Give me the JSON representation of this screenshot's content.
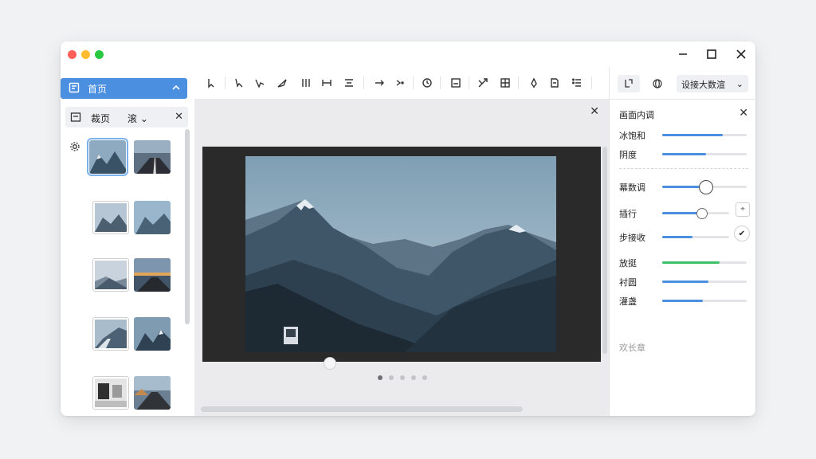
{
  "window": {
    "controls": {
      "minimize": "–",
      "maximize": "☐",
      "close": "✕"
    }
  },
  "sidebar": {
    "home_label": "首页",
    "panel": {
      "label": "裁页",
      "dropdown": "滚",
      "close": "✕"
    },
    "thumbnails": [
      {
        "icon": "mountain-thumbnail"
      },
      {
        "icon": "road-thumbnail"
      },
      {
        "icon": "mountain-thumbnail"
      },
      {
        "icon": "mountain-thumbnail"
      },
      {
        "icon": "mountain-thumbnail"
      },
      {
        "icon": "road-thumbnail"
      },
      {
        "icon": "road-thumbnail"
      },
      {
        "icon": "mountain-thumbnail"
      },
      {
        "icon": "room-thumbnail"
      },
      {
        "icon": "road-thumbnail"
      }
    ]
  },
  "toolbar": {
    "tools": [
      "select",
      "pointer",
      "lasso",
      "brush",
      "flip",
      "align",
      "separator",
      "spacing",
      "dots",
      "timer",
      "export",
      "transform",
      "grid",
      "pen",
      "document",
      "list"
    ]
  },
  "canvas": {
    "close": "✕",
    "pages": 5,
    "active_page": 1
  },
  "right_panel": {
    "dropdown_label": "设接大数渲",
    "dropdown_chevron": "⌄",
    "title": "画面内调",
    "close": "✕",
    "adjustments": [
      {
        "label": "冰饱和",
        "value": 0.72,
        "color": "#4a8fe0"
      },
      {
        "label": "阴度",
        "value": 0.52,
        "color": "#4a8fe0"
      },
      {
        "label": "幕数调",
        "value": 0.52,
        "color": "#4a8fe0",
        "knob": true
      },
      {
        "label": "插行",
        "value": 0.6,
        "color": "#4a8fe0",
        "knob": true,
        "button": "⌖"
      },
      {
        "label": "步接收",
        "value": 0.45,
        "color": "#4a8fe0",
        "circle_button": "✔"
      },
      {
        "label": "放挺",
        "value": 0.68,
        "color": "#3ec06b"
      },
      {
        "label": "衬圆",
        "value": 0.55,
        "color": "#4a8fe0"
      },
      {
        "label": "灌盏",
        "value": 0.48,
        "color": "#4a8fe0"
      }
    ],
    "footer_label": "欢长章"
  }
}
